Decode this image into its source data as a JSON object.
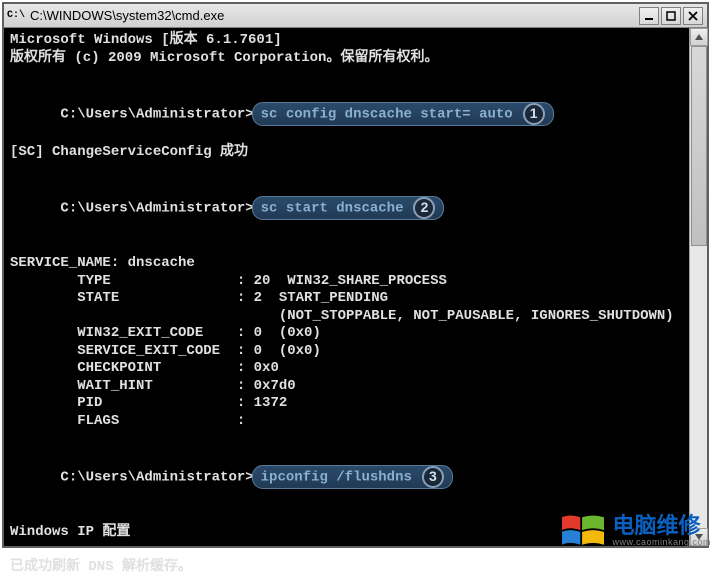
{
  "window": {
    "title": "C:\\WINDOWS\\system32\\cmd.exe",
    "icon_label": "C:\\"
  },
  "terminal": {
    "line1": "Microsoft Windows [版本 6.1.7601]",
    "line2": "版权所有 (c) 2009 Microsoft Corporation。保留所有权利。",
    "prompt1_prefix": "C:\\Users\\Administrator>",
    "cmd1": "sc config dnscache start= auto",
    "num1": "1",
    "result1": "[SC] ChangeServiceConfig 成功",
    "prompt2_prefix": "C:\\Users\\Administrator>",
    "cmd2": "sc start dnscache",
    "num2": "2",
    "svc_header": "SERVICE_NAME: dnscache",
    "svc_type": "        TYPE               : 20  WIN32_SHARE_PROCESS",
    "svc_state": "        STATE              : 2  START_PENDING",
    "svc_state2": "                                (NOT_STOPPABLE, NOT_PAUSABLE, IGNORES_SHUTDOWN)",
    "svc_win32": "        WIN32_EXIT_CODE    : 0  (0x0)",
    "svc_service": "        SERVICE_EXIT_CODE  : 0  (0x0)",
    "svc_checkpoint": "        CHECKPOINT         : 0x0",
    "svc_wait": "        WAIT_HINT          : 0x7d0",
    "svc_pid": "        PID                : 1372",
    "svc_flags": "        FLAGS              :",
    "prompt3_prefix": "C:\\Users\\Administrator>",
    "cmd3": "ipconfig /flushdns",
    "num3": "3",
    "ipcfg_header": "Windows IP 配置",
    "ipcfg_result": "已成功刷新 DNS 解析缓存。"
  },
  "watermark": {
    "title": "电脑维修",
    "subtitle": "www.caominkang.com"
  }
}
